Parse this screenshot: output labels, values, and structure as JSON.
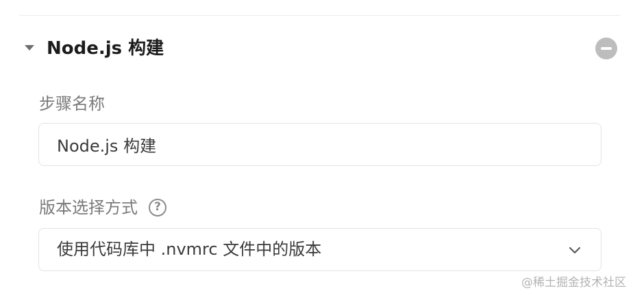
{
  "section": {
    "title": "Node.js 构建"
  },
  "fields": {
    "step_name": {
      "label": "步骤名称",
      "value": "Node.js 构建"
    },
    "version_method": {
      "label": "版本选择方式",
      "help_symbol": "?",
      "selected_value": "使用代码库中 .nvmrc 文件中的版本"
    }
  },
  "icons": {
    "collapse": "caret-down-icon",
    "remove": "minus-circle-icon",
    "help": "question-circle-icon",
    "dropdown": "chevron-down-icon"
  },
  "watermark": "@稀土掘金技术社区"
}
